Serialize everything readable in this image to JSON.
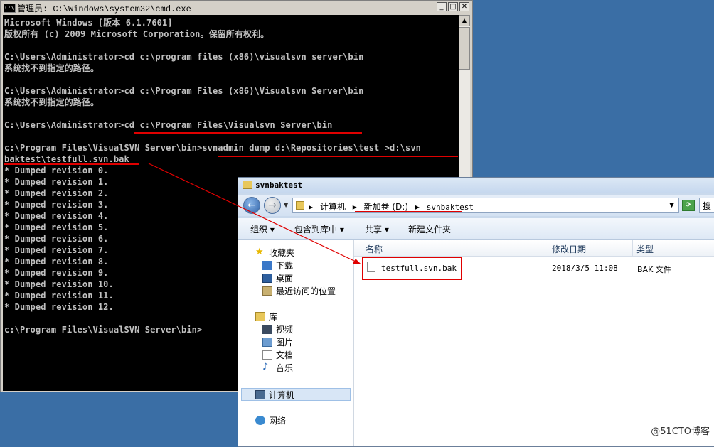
{
  "cmd": {
    "title": "管理员: C:\\Windows\\system32\\cmd.exe",
    "icon_text": "C:\\",
    "buttons": {
      "minimize": "_",
      "maximize": "□",
      "close": "✕"
    },
    "lines": [
      "Microsoft Windows [版本 6.1.7601]",
      "版权所有 (c) 2009 Microsoft Corporation。保留所有权利。",
      "",
      "C:\\Users\\Administrator>cd c:\\program files (x86)\\visualsvn server\\bin",
      "系统找不到指定的路径。",
      "",
      "C:\\Users\\Administrator>cd c:\\Program Files (x86)\\Visualsvn Server\\bin",
      "系统找不到指定的路径。",
      "",
      "C:\\Users\\Administrator>cd c:\\Program Files\\Visualsvn Server\\bin",
      "",
      "c:\\Program Files\\VisualSVN Server\\bin>svnadmin dump d:\\Repositories\\test >d:\\svn",
      "baktest\\testfull.svn.bak",
      "* Dumped revision 0.",
      "* Dumped revision 1.",
      "* Dumped revision 2.",
      "* Dumped revision 3.",
      "* Dumped revision 4.",
      "* Dumped revision 5.",
      "* Dumped revision 6.",
      "* Dumped revision 7.",
      "* Dumped revision 8.",
      "* Dumped revision 9.",
      "* Dumped revision 10.",
      "* Dumped revision 11.",
      "* Dumped revision 12.",
      "",
      "c:\\Program Files\\VisualSVN Server\\bin>"
    ]
  },
  "explorer": {
    "title": "svnbaktest",
    "address": {
      "crumb1": "计算机",
      "crumb2": "新加卷 (D:)",
      "crumb3": "svnbaktest"
    },
    "search_text": "搜",
    "toolbar": {
      "organize": "组织 ▾",
      "include_library": "包含到库中 ▾",
      "share": "共享 ▾",
      "new_folder": "新建文件夹"
    },
    "nav": {
      "favorites": "收藏夹",
      "downloads": "下载",
      "desktop": "桌面",
      "recent": "最近访问的位置",
      "libraries": "库",
      "videos": "视频",
      "pictures": "图片",
      "documents": "文档",
      "music": "音乐",
      "computer": "计算机",
      "network": "网络"
    },
    "columns": {
      "name": "名称",
      "date": "修改日期",
      "type": "类型"
    },
    "files": [
      {
        "name": "testfull.svn.bak",
        "date": "2018/3/5 11:08",
        "type": "BAK 文件"
      }
    ]
  },
  "watermark": "@51CTO博客",
  "colors": {
    "annotation": "#e00000",
    "desktop": "#3a6ea5",
    "console_bg": "#000000",
    "console_text": "#c0c0c0"
  }
}
